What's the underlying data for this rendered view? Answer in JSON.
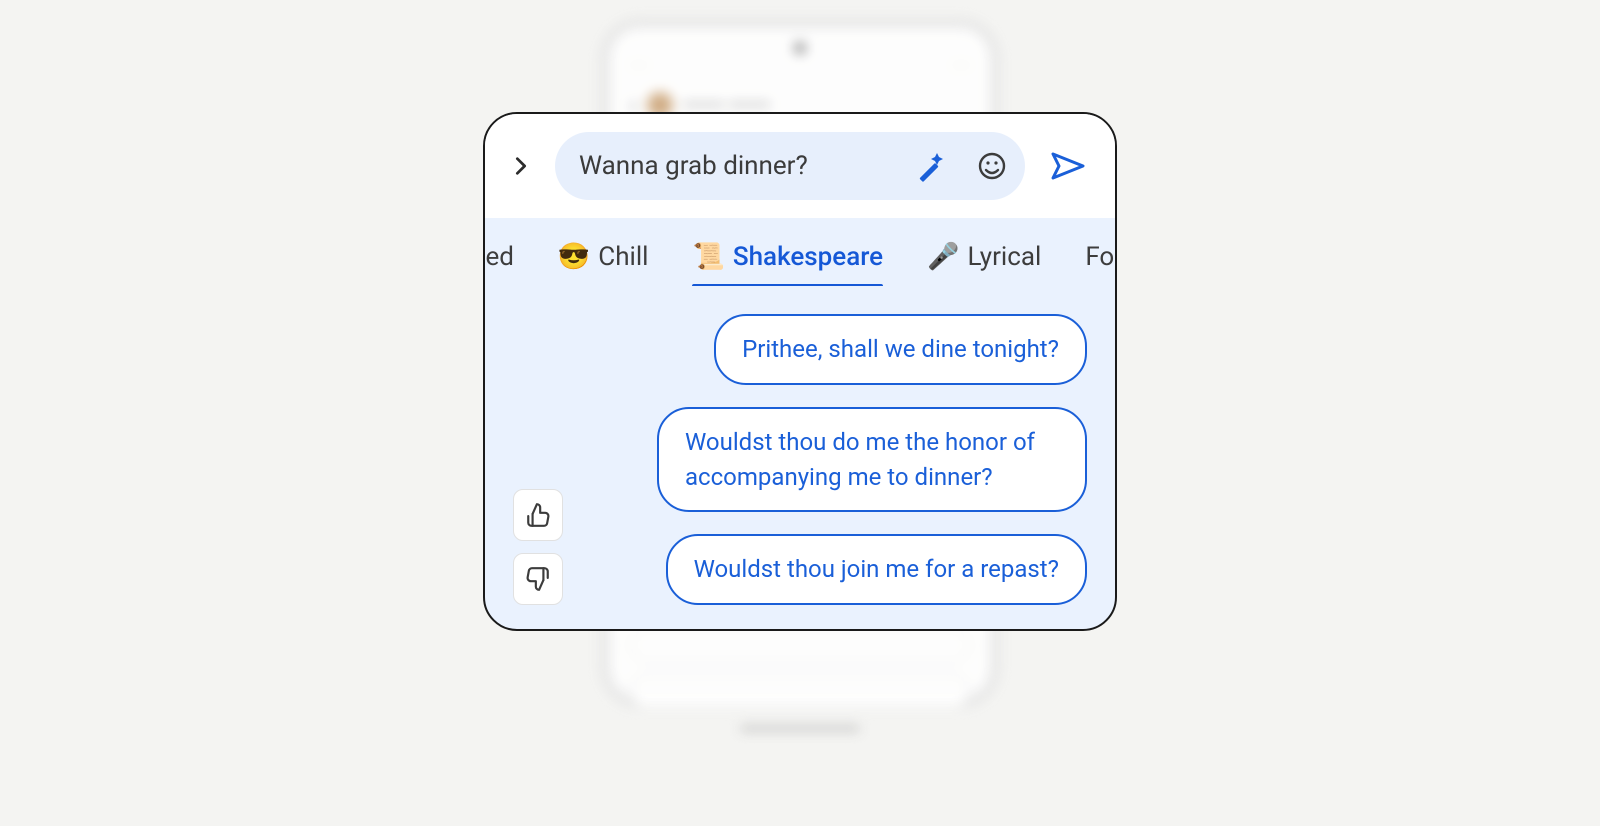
{
  "compose": {
    "text": "Wanna grab dinner?"
  },
  "tabs": {
    "partial_left": "cited",
    "items": [
      {
        "emoji": "😎",
        "label": "Chill",
        "active": false
      },
      {
        "emoji": "📜",
        "label": "Shakespeare",
        "active": true
      },
      {
        "emoji": "🎤",
        "label": "Lyrical",
        "active": false
      }
    ],
    "partial_right": "For"
  },
  "suggestions": [
    "Prithee, shall we dine tonight?",
    "Wouldst thou do me the honor of accompanying me to dinner?",
    "Wouldst thou join me for a repast?"
  ],
  "colors": {
    "accent": "#1a5fd8",
    "pill_bg": "#e7effc",
    "card_bg": "#eaf2fe"
  }
}
